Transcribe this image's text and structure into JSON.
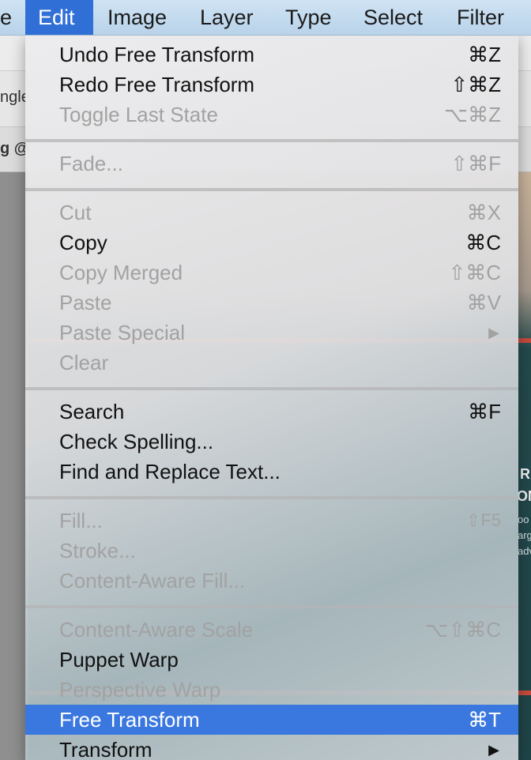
{
  "menubar": {
    "items": [
      {
        "label": "e"
      },
      {
        "label": "Edit"
      },
      {
        "label": "Image"
      },
      {
        "label": "Layer"
      },
      {
        "label": "Type"
      },
      {
        "label": "Select"
      },
      {
        "label": "Filter"
      }
    ]
  },
  "background": {
    "toolbar_snippet": "ngle",
    "tab_snippet": "g @",
    "canvas_heading_1": "R",
    "canvas_heading_2": "ON",
    "canvas_text_1": "oo",
    "canvas_text_2": "arg",
    "canvas_text_3": "adv"
  },
  "edit_menu": {
    "items": [
      {
        "label": "Undo Free Transform",
        "shortcut": "⌘Z",
        "enabled": true
      },
      {
        "label": "Redo Free Transform",
        "shortcut": "⇧⌘Z",
        "enabled": true
      },
      {
        "label": "Toggle Last State",
        "shortcut": "⌥⌘Z",
        "enabled": false
      },
      {
        "label": "Fade...",
        "shortcut": "⇧⌘F",
        "enabled": false
      },
      {
        "label": "Cut",
        "shortcut": "⌘X",
        "enabled": false
      },
      {
        "label": "Copy",
        "shortcut": "⌘C",
        "enabled": true
      },
      {
        "label": "Copy Merged",
        "shortcut": "⇧⌘C",
        "enabled": false
      },
      {
        "label": "Paste",
        "shortcut": "⌘V",
        "enabled": false
      },
      {
        "label": "Paste Special",
        "shortcut": "▶",
        "enabled": false
      },
      {
        "label": "Clear",
        "shortcut": "",
        "enabled": false
      },
      {
        "label": "Search",
        "shortcut": "⌘F",
        "enabled": true
      },
      {
        "label": "Check Spelling...",
        "shortcut": "",
        "enabled": true
      },
      {
        "label": "Find and Replace Text...",
        "shortcut": "",
        "enabled": true
      },
      {
        "label": "Fill...",
        "shortcut": "⇧F5",
        "enabled": false
      },
      {
        "label": "Stroke...",
        "shortcut": "",
        "enabled": false
      },
      {
        "label": "Content-Aware Fill...",
        "shortcut": "",
        "enabled": false
      },
      {
        "label": "Content-Aware Scale",
        "shortcut": "⌥⇧⌘C",
        "enabled": false
      },
      {
        "label": "Puppet Warp",
        "shortcut": "",
        "enabled": true
      },
      {
        "label": "Perspective Warp",
        "shortcut": "",
        "enabled": false
      },
      {
        "label": "Free Transform",
        "shortcut": "⌘T",
        "enabled": true,
        "highlighted": true
      },
      {
        "label": "Transform",
        "shortcut": "▶",
        "enabled": true
      }
    ]
  },
  "colors": {
    "highlight": "#3a78e0",
    "menubar_active": "#2f6fd6"
  }
}
